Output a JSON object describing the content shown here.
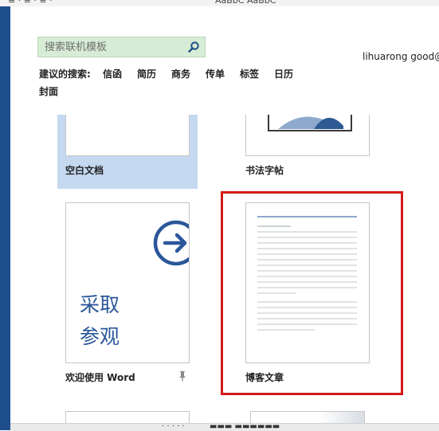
{
  "search": {
    "placeholder": "搜索联机模板",
    "value": ""
  },
  "account": {
    "user": "lihuarong good@"
  },
  "suggestions": {
    "label": "建议的搜索:",
    "items": [
      "信函",
      "简历",
      "商务",
      "传单",
      "标签",
      "日历",
      "封面"
    ]
  },
  "templates": [
    {
      "name": "空白文档",
      "selected": true
    },
    {
      "name": "书法字帖"
    },
    {
      "name": "欢迎使用 Word",
      "pinned": true,
      "thumbnail_text": [
        "采取",
        "参观"
      ]
    },
    {
      "name": "博客文章"
    }
  ],
  "colors": {
    "accent": "#1e4e8c",
    "selected_tile": "#c5d9f1",
    "search_bg": "#d7ecd6",
    "highlight": "#d11a1a",
    "word_blue": "#2b579a"
  },
  "icons": {
    "search": "search-icon",
    "arrow": "arrow-right-circle-icon",
    "pin": "pin-icon"
  }
}
